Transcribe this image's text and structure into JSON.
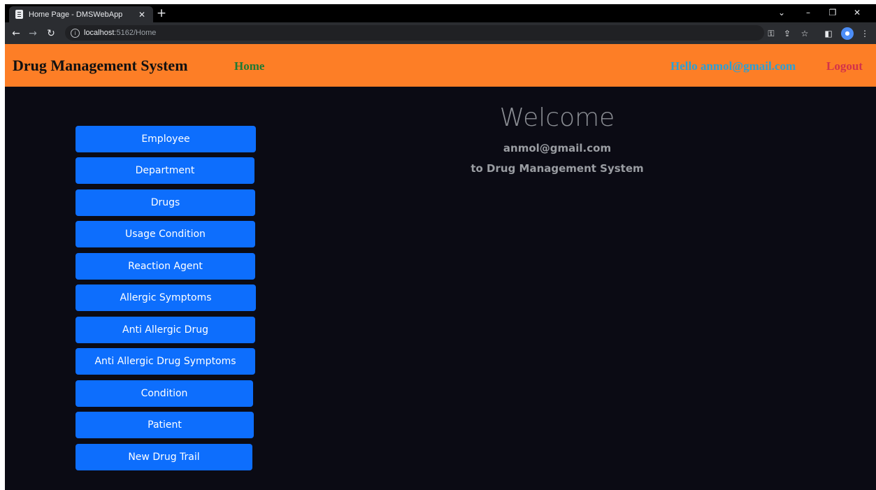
{
  "browser": {
    "tab_title": "Home Page - DMSWebApp",
    "url_host": "localhost",
    "url_path": ":5162/Home"
  },
  "navbar": {
    "brand": "Drug Management System",
    "home": "Home",
    "hello": "Hello anmol@gmail.com",
    "logout": "Logout"
  },
  "menu": [
    {
      "label": "Employee"
    },
    {
      "label": "Department"
    },
    {
      "label": "Drugs"
    },
    {
      "label": "Usage Condition"
    },
    {
      "label": "Reaction Agent"
    },
    {
      "label": "Allergic Symptoms"
    },
    {
      "label": "Anti Allergic Drug"
    },
    {
      "label": "Anti Allergic Drug Symptoms"
    },
    {
      "label": "Condition"
    },
    {
      "label": "Patient"
    },
    {
      "label": "New Drug Trail"
    }
  ],
  "welcome": {
    "title": "Welcome",
    "user": "anmol@gmail.com",
    "subtitle": "to Drug Management System"
  },
  "colors": {
    "navbar": "#fd7e26",
    "button": "#0d6efd",
    "background": "#0b0b14"
  }
}
